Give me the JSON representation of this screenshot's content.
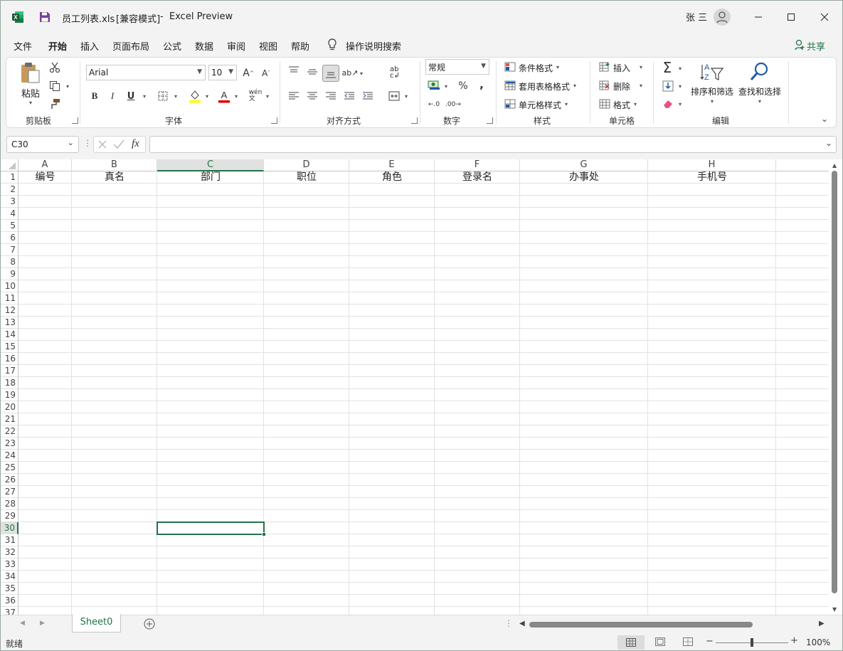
{
  "title": {
    "file_name": "员工列表.xls",
    "mode": "[兼容模式]",
    "separator": "-",
    "app": "Excel Preview",
    "user": "张 三"
  },
  "menu": {
    "items": [
      "文件",
      "开始",
      "插入",
      "页面布局",
      "公式",
      "数据",
      "审阅",
      "视图",
      "帮助"
    ],
    "active": "开始",
    "search": "操作说明搜索",
    "share": "共享"
  },
  "ribbon": {
    "clipboard": {
      "paste": "粘贴",
      "label": "剪贴板"
    },
    "font": {
      "name": "Arial",
      "size": "10",
      "bold": "B",
      "italic": "I",
      "underline": "U",
      "label": "字体"
    },
    "alignment": {
      "label": "对齐方式"
    },
    "number": {
      "format": "常规",
      "percent": "%",
      "comma": ",",
      "inc_decimal": ".00",
      "dec_decimal": ".0",
      "label": "数字"
    },
    "styles": {
      "conditional": "条件格式",
      "table": "套用表格格式",
      "cell": "单元格样式",
      "label": "样式"
    },
    "cells": {
      "insert": "插入",
      "delete": "删除",
      "format": "格式",
      "label": "单元格"
    },
    "editing": {
      "sort": "排序和筛选",
      "find": "查找和选择",
      "label": "编辑"
    }
  },
  "formula_bar": {
    "name_box": "C30",
    "fx": "fx",
    "value": ""
  },
  "sheet": {
    "columns": [
      "A",
      "B",
      "C",
      "D",
      "E",
      "F",
      "G",
      "H"
    ],
    "selected_column": "C",
    "header_row": [
      "编号",
      "真名",
      "部门",
      "职位",
      "角色",
      "登录名",
      "办事处",
      "手机号"
    ],
    "rows": [
      "1",
      "2",
      "3",
      "4",
      "5",
      "6",
      "7",
      "8",
      "9",
      "10",
      "11",
      "12",
      "13",
      "14",
      "15",
      "16",
      "17",
      "18",
      "19",
      "20",
      "21",
      "22",
      "23",
      "24",
      "25",
      "26",
      "27",
      "28",
      "29",
      "30",
      "31",
      "32",
      "33",
      "34",
      "35",
      "36",
      "37"
    ],
    "selected_row": "30",
    "selected_cell": "C30"
  },
  "tabs": {
    "sheets": [
      "Sheet0"
    ],
    "active": "Sheet0"
  },
  "status": {
    "ready": "就绪",
    "zoom": "100%",
    "zoom_minus": "−",
    "zoom_plus": "+"
  },
  "colors": {
    "accent": "#217346",
    "excel_icon": "#1d6f42",
    "save_icon": "#7b3f98"
  }
}
